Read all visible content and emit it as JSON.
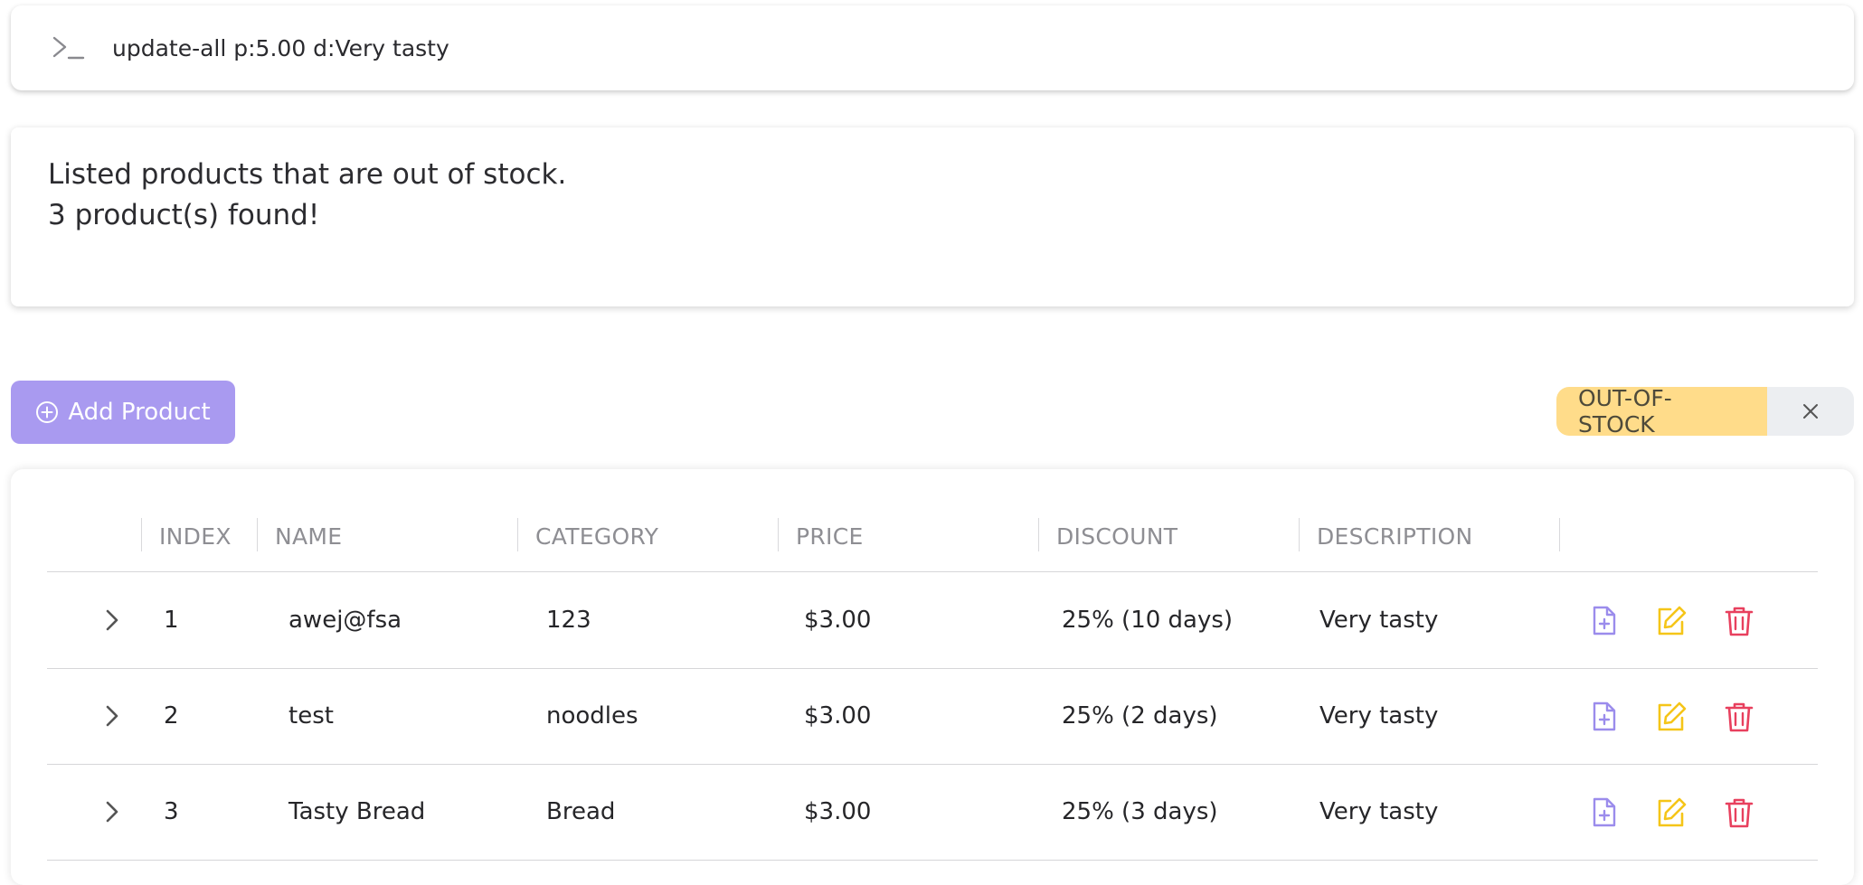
{
  "command": {
    "value": "update-all p:5.00 d:Very tasty",
    "prompt_icon": "terminal-prompt-icon"
  },
  "result": {
    "line1": "Listed products that are out of stock.",
    "line2": "3 product(s) found!"
  },
  "toolbar": {
    "add_label": "Add Product",
    "add_icon": "plus-circle-icon"
  },
  "filter_tag": {
    "label": "OUT-OF-STOCK",
    "close_icon": "close-icon"
  },
  "table": {
    "headers": [
      "INDEX",
      "NAME",
      "CATEGORY",
      "PRICE",
      "DISCOUNT",
      "DESCRIPTION"
    ],
    "rows": [
      {
        "index": "1",
        "name": "awej@fsa",
        "category": "123",
        "price": "$3.00",
        "discount": "25% (10 days)",
        "description": "Very tasty"
      },
      {
        "index": "2",
        "name": "test",
        "category": "noodles",
        "price": "$3.00",
        "discount": "25% (2 days)",
        "description": "Very tasty"
      },
      {
        "index": "3",
        "name": "Tasty Bread",
        "category": "Bread",
        "price": "$3.00",
        "discount": "25% (3 days)",
        "description": "Very tasty"
      }
    ]
  },
  "colors": {
    "accent": "#a99af0",
    "tag": "#ffdc8a",
    "edit": "#f5c518",
    "delete": "#e8405e",
    "view": "#9b8cec"
  }
}
